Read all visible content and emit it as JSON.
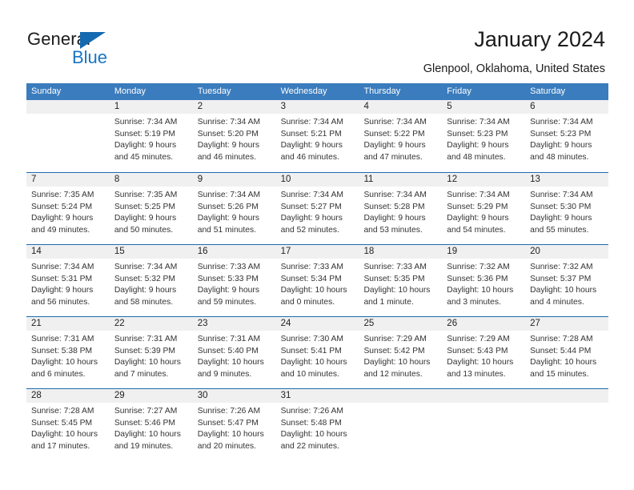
{
  "logo": {
    "word1": "General",
    "word2": "Blue",
    "triangle_color": "#1569b0",
    "blue_color": "#1675c5"
  },
  "header": {
    "title": "January 2024",
    "subtitle": "Glenpool, Oklahoma, United States"
  },
  "theme": {
    "header_band": "#3a7cbd",
    "row_divider": "#1b6cb0",
    "daynum_band": "#f0f0f0"
  },
  "calendar": {
    "weekdays": [
      "Sunday",
      "Monday",
      "Tuesday",
      "Wednesday",
      "Thursday",
      "Friday",
      "Saturday"
    ],
    "weeks": [
      [
        {
          "day": "",
          "lines": [
            "",
            "",
            "",
            ""
          ]
        },
        {
          "day": "1",
          "lines": [
            "Sunrise: 7:34 AM",
            "Sunset: 5:19 PM",
            "Daylight: 9 hours",
            "and 45 minutes."
          ]
        },
        {
          "day": "2",
          "lines": [
            "Sunrise: 7:34 AM",
            "Sunset: 5:20 PM",
            "Daylight: 9 hours",
            "and 46 minutes."
          ]
        },
        {
          "day": "3",
          "lines": [
            "Sunrise: 7:34 AM",
            "Sunset: 5:21 PM",
            "Daylight: 9 hours",
            "and 46 minutes."
          ]
        },
        {
          "day": "4",
          "lines": [
            "Sunrise: 7:34 AM",
            "Sunset: 5:22 PM",
            "Daylight: 9 hours",
            "and 47 minutes."
          ]
        },
        {
          "day": "5",
          "lines": [
            "Sunrise: 7:34 AM",
            "Sunset: 5:23 PM",
            "Daylight: 9 hours",
            "and 48 minutes."
          ]
        },
        {
          "day": "6",
          "lines": [
            "Sunrise: 7:34 AM",
            "Sunset: 5:23 PM",
            "Daylight: 9 hours",
            "and 48 minutes."
          ]
        }
      ],
      [
        {
          "day": "7",
          "lines": [
            "Sunrise: 7:35 AM",
            "Sunset: 5:24 PM",
            "Daylight: 9 hours",
            "and 49 minutes."
          ]
        },
        {
          "day": "8",
          "lines": [
            "Sunrise: 7:35 AM",
            "Sunset: 5:25 PM",
            "Daylight: 9 hours",
            "and 50 minutes."
          ]
        },
        {
          "day": "9",
          "lines": [
            "Sunrise: 7:34 AM",
            "Sunset: 5:26 PM",
            "Daylight: 9 hours",
            "and 51 minutes."
          ]
        },
        {
          "day": "10",
          "lines": [
            "Sunrise: 7:34 AM",
            "Sunset: 5:27 PM",
            "Daylight: 9 hours",
            "and 52 minutes."
          ]
        },
        {
          "day": "11",
          "lines": [
            "Sunrise: 7:34 AM",
            "Sunset: 5:28 PM",
            "Daylight: 9 hours",
            "and 53 minutes."
          ]
        },
        {
          "day": "12",
          "lines": [
            "Sunrise: 7:34 AM",
            "Sunset: 5:29 PM",
            "Daylight: 9 hours",
            "and 54 minutes."
          ]
        },
        {
          "day": "13",
          "lines": [
            "Sunrise: 7:34 AM",
            "Sunset: 5:30 PM",
            "Daylight: 9 hours",
            "and 55 minutes."
          ]
        }
      ],
      [
        {
          "day": "14",
          "lines": [
            "Sunrise: 7:34 AM",
            "Sunset: 5:31 PM",
            "Daylight: 9 hours",
            "and 56 minutes."
          ]
        },
        {
          "day": "15",
          "lines": [
            "Sunrise: 7:34 AM",
            "Sunset: 5:32 PM",
            "Daylight: 9 hours",
            "and 58 minutes."
          ]
        },
        {
          "day": "16",
          "lines": [
            "Sunrise: 7:33 AM",
            "Sunset: 5:33 PM",
            "Daylight: 9 hours",
            "and 59 minutes."
          ]
        },
        {
          "day": "17",
          "lines": [
            "Sunrise: 7:33 AM",
            "Sunset: 5:34 PM",
            "Daylight: 10 hours",
            "and 0 minutes."
          ]
        },
        {
          "day": "18",
          "lines": [
            "Sunrise: 7:33 AM",
            "Sunset: 5:35 PM",
            "Daylight: 10 hours",
            "and 1 minute."
          ]
        },
        {
          "day": "19",
          "lines": [
            "Sunrise: 7:32 AM",
            "Sunset: 5:36 PM",
            "Daylight: 10 hours",
            "and 3 minutes."
          ]
        },
        {
          "day": "20",
          "lines": [
            "Sunrise: 7:32 AM",
            "Sunset: 5:37 PM",
            "Daylight: 10 hours",
            "and 4 minutes."
          ]
        }
      ],
      [
        {
          "day": "21",
          "lines": [
            "Sunrise: 7:31 AM",
            "Sunset: 5:38 PM",
            "Daylight: 10 hours",
            "and 6 minutes."
          ]
        },
        {
          "day": "22",
          "lines": [
            "Sunrise: 7:31 AM",
            "Sunset: 5:39 PM",
            "Daylight: 10 hours",
            "and 7 minutes."
          ]
        },
        {
          "day": "23",
          "lines": [
            "Sunrise: 7:31 AM",
            "Sunset: 5:40 PM",
            "Daylight: 10 hours",
            "and 9 minutes."
          ]
        },
        {
          "day": "24",
          "lines": [
            "Sunrise: 7:30 AM",
            "Sunset: 5:41 PM",
            "Daylight: 10 hours",
            "and 10 minutes."
          ]
        },
        {
          "day": "25",
          "lines": [
            "Sunrise: 7:29 AM",
            "Sunset: 5:42 PM",
            "Daylight: 10 hours",
            "and 12 minutes."
          ]
        },
        {
          "day": "26",
          "lines": [
            "Sunrise: 7:29 AM",
            "Sunset: 5:43 PM",
            "Daylight: 10 hours",
            "and 13 minutes."
          ]
        },
        {
          "day": "27",
          "lines": [
            "Sunrise: 7:28 AM",
            "Sunset: 5:44 PM",
            "Daylight: 10 hours",
            "and 15 minutes."
          ]
        }
      ],
      [
        {
          "day": "28",
          "lines": [
            "Sunrise: 7:28 AM",
            "Sunset: 5:45 PM",
            "Daylight: 10 hours",
            "and 17 minutes."
          ]
        },
        {
          "day": "29",
          "lines": [
            "Sunrise: 7:27 AM",
            "Sunset: 5:46 PM",
            "Daylight: 10 hours",
            "and 19 minutes."
          ]
        },
        {
          "day": "30",
          "lines": [
            "Sunrise: 7:26 AM",
            "Sunset: 5:47 PM",
            "Daylight: 10 hours",
            "and 20 minutes."
          ]
        },
        {
          "day": "31",
          "lines": [
            "Sunrise: 7:26 AM",
            "Sunset: 5:48 PM",
            "Daylight: 10 hours",
            "and 22 minutes."
          ]
        },
        {
          "day": "",
          "lines": [
            "",
            "",
            "",
            ""
          ]
        },
        {
          "day": "",
          "lines": [
            "",
            "",
            "",
            ""
          ]
        },
        {
          "day": "",
          "lines": [
            "",
            "",
            "",
            ""
          ]
        }
      ]
    ]
  }
}
